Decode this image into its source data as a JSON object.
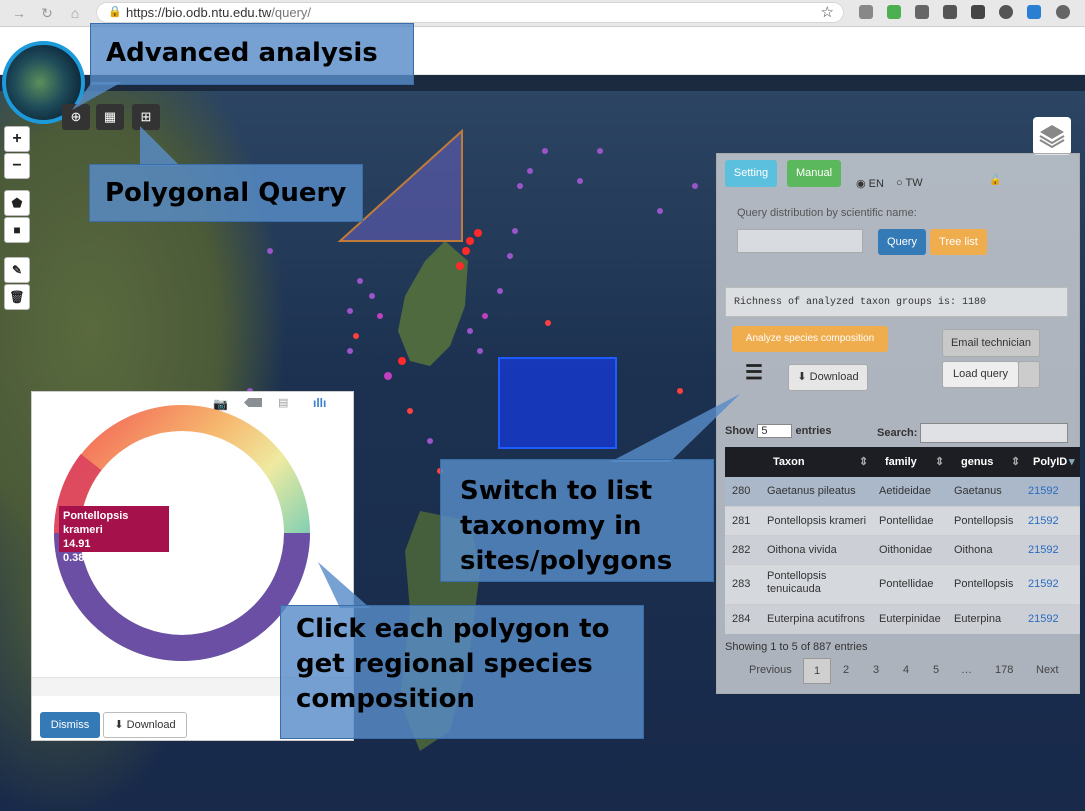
{
  "browser": {
    "url_host": "https://bio.odb.ntu.edu.tw",
    "url_path": "/query/"
  },
  "callouts": {
    "advanced": "Advanced analysis",
    "polygonal": "Polygonal Query",
    "switch_list": "Switch to list taxonomy in sites/polygons",
    "click_polygon": "Click each polygon to get regional species composition"
  },
  "map_tools": {
    "zoom_in": "+",
    "zoom_out": "−"
  },
  "panel": {
    "setting_label": "Setting",
    "manual_label": "Manual",
    "lang_en": "EN",
    "lang_tw": "TW",
    "query_prompt": "Query distribution by scientific name:",
    "query_button": "Query",
    "tree_button": "Tree list",
    "richness_text": "Richness of analyzed taxon groups is: 1180",
    "analyze_button": "Analyze species composition",
    "email_button": "Email technician",
    "download_button": "Download",
    "load_query_button": "Load query",
    "show_label": "Show",
    "entries_value": "5",
    "entries_label": "entries",
    "search_label": "Search:",
    "colors": {
      "setting": "#5bc0de",
      "manual": "#5cb85c",
      "query": "#337ab7",
      "tree": "#f0ad4e"
    }
  },
  "table": {
    "headers": [
      "Taxon",
      "family",
      "genus",
      "PolyID"
    ],
    "rows": [
      {
        "id": "280",
        "taxon": "Gaetanus pileatus",
        "family": "Aetideidae",
        "genus": "Gaetanus",
        "polyid": "21592"
      },
      {
        "id": "281",
        "taxon": "Pontellopsis krameri",
        "family": "Pontellidae",
        "genus": "Pontellopsis",
        "polyid": "21592"
      },
      {
        "id": "282",
        "taxon": "Oithona vivida",
        "family": "Oithonidae",
        "genus": "Oithona",
        "polyid": "21592"
      },
      {
        "id": "283",
        "taxon": "Pontellopsis tenuicauda",
        "family": "Pontellidae",
        "genus": "Pontellopsis",
        "polyid": "21592"
      },
      {
        "id": "284",
        "taxon": "Euterpina acutifrons",
        "family": "Euterpinidae",
        "genus": "Euterpina",
        "polyid": "21592"
      }
    ],
    "info": "Showing 1 to 5 of 887 entries",
    "pagination": [
      "Previous",
      "1",
      "2",
      "3",
      "4",
      "5",
      "…",
      "178",
      "Next"
    ]
  },
  "chart": {
    "tooltip_name": "Pontellopsis krameri",
    "tooltip_value": "14.91",
    "tooltip_pct": "0.382%",
    "dismiss_label": "Dismiss",
    "download_label": "Download"
  }
}
